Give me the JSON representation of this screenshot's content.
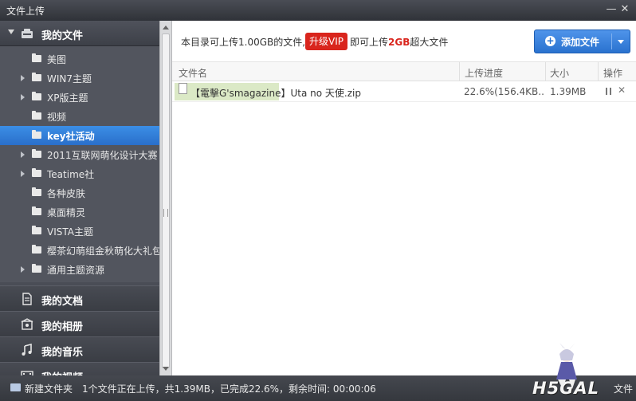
{
  "window": {
    "title": "文件上传",
    "minimize": "—",
    "close": "✕"
  },
  "sidebar": {
    "section_title": "我的文件",
    "items": [
      {
        "label": "美图",
        "expandable": false
      },
      {
        "label": "WIN7主题",
        "expandable": true
      },
      {
        "label": "XP版主题",
        "expandable": true
      },
      {
        "label": "视频",
        "expandable": false
      },
      {
        "label": "key社活动",
        "expandable": false,
        "active": true
      },
      {
        "label": "2011互联网萌化设计大赛",
        "expandable": true
      },
      {
        "label": "Teatime社",
        "expandable": true
      },
      {
        "label": "各种皮肤",
        "expandable": false
      },
      {
        "label": "桌面精灵",
        "expandable": false
      },
      {
        "label": "VISTA主题",
        "expandable": false
      },
      {
        "label": "樱茶幻萌组金秋萌化大礼包",
        "expandable": false
      },
      {
        "label": "通用主题资源",
        "expandable": true
      }
    ],
    "categories": [
      {
        "label": "我的文档",
        "icon": "document-icon"
      },
      {
        "label": "我的相册",
        "icon": "photo-album-icon"
      },
      {
        "label": "我的音乐",
        "icon": "music-note-icon"
      },
      {
        "label": "我的视频",
        "icon": "video-icon"
      }
    ]
  },
  "main": {
    "info_text_1": "本目录可上传1.00GB的文件,",
    "vip_button": "升级VIP",
    "info_text_2_prefix": "即可上传",
    "info_text_2_highlight": "2GB",
    "info_text_2_suffix": "超大文件",
    "add_button": "添加文件",
    "columns": {
      "name": "文件名",
      "progress": "上传进度",
      "size": "大小",
      "action": "操作"
    },
    "rows": [
      {
        "name": "【電擊G'smagazine】Uta no 天使.zip",
        "progress": "22.6%(156.4KB...",
        "size": "1.39MB"
      }
    ]
  },
  "statusbar": {
    "new_folder": "新建文件夹",
    "status": "1个文件正在上传，共1.39MB，已完成22.6%，剩余时间: 00:00:06",
    "logo": "H5GAL",
    "tail": "文件"
  },
  "colors": {
    "accent_blue": "#2a72cf",
    "vip_red": "#d9251d",
    "active_item": "#3b8ee6",
    "row_highlight": "#dbe9c6"
  }
}
